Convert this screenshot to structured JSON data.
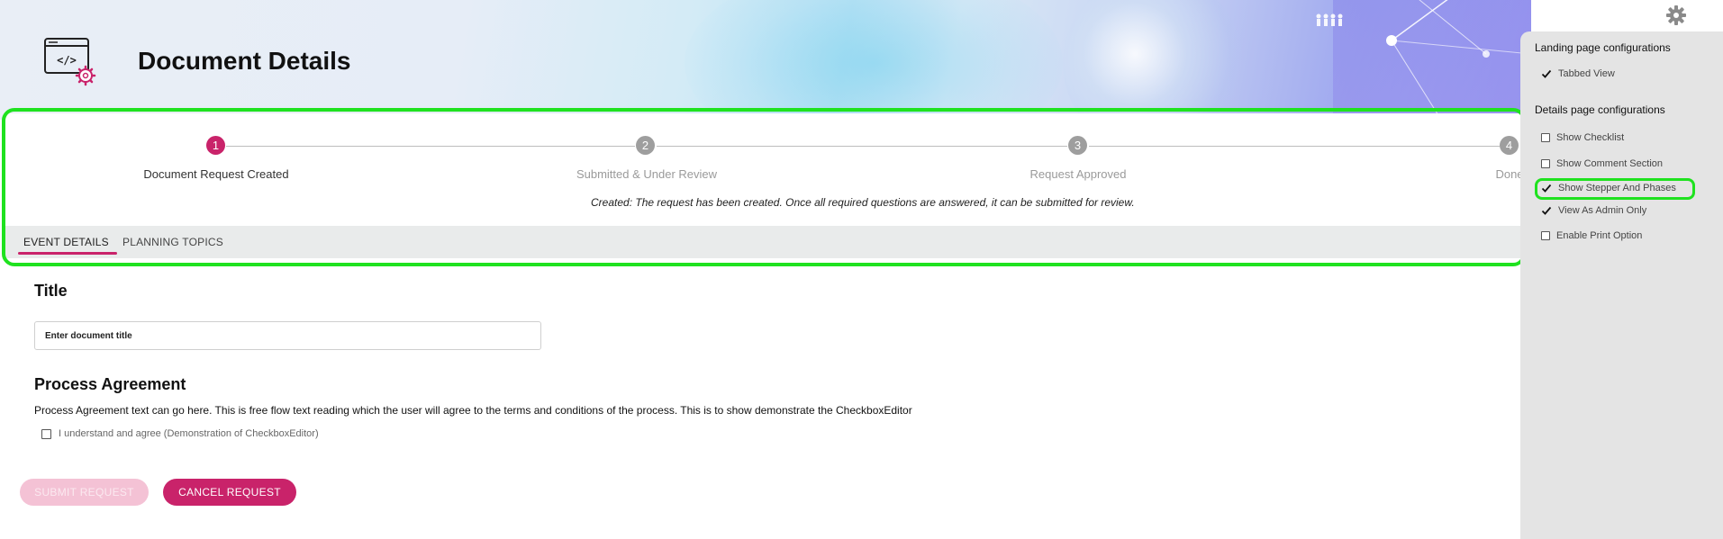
{
  "header": {
    "title": "Document Details",
    "logo_icon": "code-document-settings-icon"
  },
  "stepper": {
    "steps": [
      {
        "number": "1",
        "label": "Document Request Created",
        "active": true
      },
      {
        "number": "2",
        "label": "Submitted & Under Review",
        "active": false
      },
      {
        "number": "3",
        "label": "Request Approved",
        "active": false
      },
      {
        "number": "4",
        "label": "Done",
        "active": false
      }
    ],
    "description": "Created: The request has been created. Once all required questions are answered, it can be submitted for review.",
    "active_color": "#c9236a",
    "inactive_color": "#9e9e9e"
  },
  "tabs": [
    {
      "label": "EVENT DETAILS",
      "active": true
    },
    {
      "label": "PLANNING TOPICS",
      "active": false
    }
  ],
  "form": {
    "title_heading": "Title",
    "title_placeholder": "Enter document title",
    "agreement_heading": "Process Agreement",
    "agreement_text": "Process Agreement text can go here. This is free flow text reading which the user will agree to the terms and conditions of the process. This is to show demonstrate the CheckboxEditor",
    "agreement_checkbox_label": "I understand and agree (Demonstration of CheckboxEditor)",
    "agreement_checked": false
  },
  "buttons": {
    "submit": "SUBMIT REQUEST",
    "cancel": "CANCEL REQUEST"
  },
  "config_panel": {
    "landing_heading": "Landing page configurations",
    "landing_options": [
      {
        "label": "Tabbed View",
        "checked": true
      }
    ],
    "details_heading": "Details page configurations",
    "details_options": [
      {
        "label": "Show Checklist",
        "checked": false
      },
      {
        "label": "Show Comment Section",
        "checked": false
      },
      {
        "label": "Show Stepper And Phases",
        "checked": true
      },
      {
        "label": "View As Admin Only",
        "checked": true
      },
      {
        "label": "Enable Print Option",
        "checked": false
      }
    ]
  },
  "colors": {
    "accent": "#c9236a",
    "highlight": "#1fe21f",
    "panel_bg": "#e4e4e4"
  }
}
